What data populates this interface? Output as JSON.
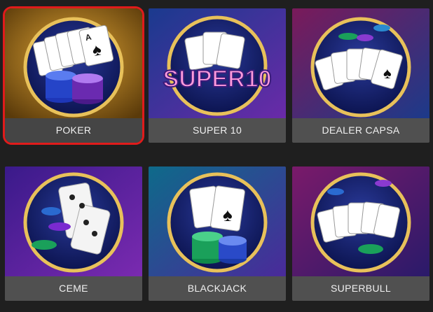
{
  "games": [
    {
      "id": "poker",
      "label": "POKER",
      "selected": true,
      "icon": "poker-cards-chips-icon",
      "bg": [
        "#7a5a15",
        "#c08a25"
      ],
      "accent": "#e9c46a"
    },
    {
      "id": "super10",
      "label": "SUPER 10",
      "selected": false,
      "icon": "super-10-logo-icon",
      "logo_text": "SUPER10",
      "bg": [
        "#1a2b6e",
        "#5a2aa0"
      ],
      "accent": "#e9c46a"
    },
    {
      "id": "dealer-capsa",
      "label": "DEALER CAPSA",
      "selected": false,
      "icon": "dealer-capsa-cards-icon",
      "bg": [
        "#5a1a6a",
        "#1c2f7a"
      ],
      "accent": "#e9c46a"
    },
    {
      "id": "ceme",
      "label": "CEME",
      "selected": false,
      "icon": "ceme-dominoes-icon",
      "bg": [
        "#3a1a7a",
        "#6a2aa0"
      ],
      "accent": "#e9c46a"
    },
    {
      "id": "blackjack",
      "label": "BLACKJACK",
      "selected": false,
      "icon": "blackjack-cards-chips-icon",
      "bg": [
        "#0e4a6a",
        "#3a2a8a"
      ],
      "accent": "#e9c46a"
    },
    {
      "id": "superbull",
      "label": "SUPERBULL",
      "selected": false,
      "icon": "superbull-cards-chips-icon",
      "bg": [
        "#5a1a6a",
        "#2a1a5a"
      ],
      "accent": "#e9c46a"
    }
  ]
}
